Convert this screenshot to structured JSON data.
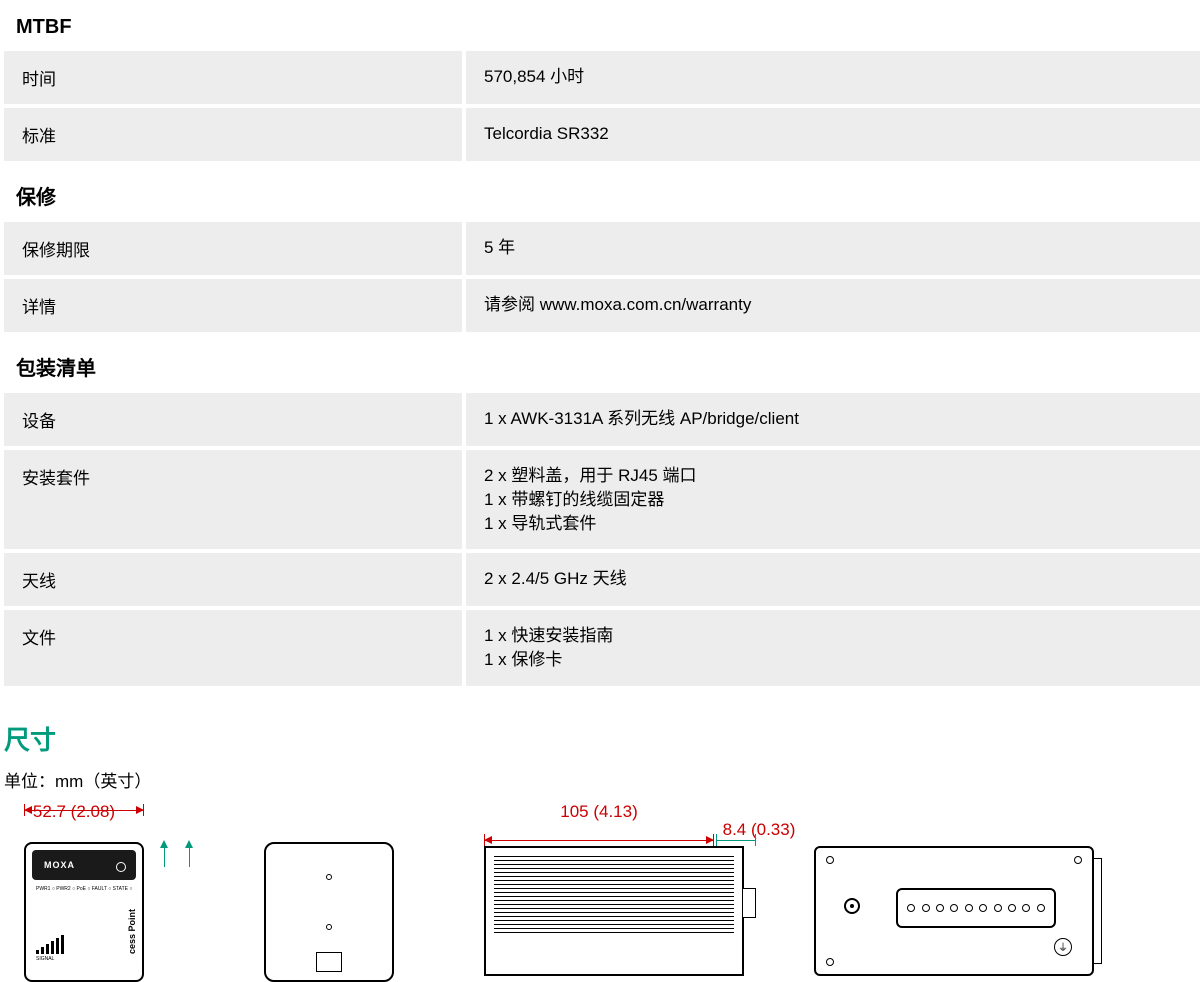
{
  "sections": {
    "mtbf": {
      "header": "MTBF",
      "rows": {
        "time_label": "时间",
        "time_value": "570,854 小时",
        "standard_label": "标准",
        "standard_value": "Telcordia SR332"
      }
    },
    "warranty": {
      "header": "保修",
      "rows": {
        "period_label": "保修期限",
        "period_value": "5 年",
        "details_label": "详情",
        "details_value": "请参阅 www.moxa.com.cn/warranty"
      }
    },
    "package": {
      "header": "包装清单",
      "rows": {
        "device_label": "设备",
        "device_value": "1 x AWK-3131A 系列无线 AP/bridge/client",
        "mounting_label": "安装套件",
        "mounting_value": "2 x 塑料盖，用于 RJ45 端口\n1 x 带螺钉的线缆固定器\n1 x 导轨式套件",
        "antenna_label": "天线",
        "antenna_value": "2 x 2.4/5 GHz 天线",
        "docs_label": "文件",
        "docs_value": "1 x 快速安装指南\n1 x 保修卡"
      }
    }
  },
  "dimensions": {
    "header": "尺寸",
    "unit": "单位：mm（英寸）",
    "dim_front_width": "52.7 (2.08)",
    "dim_side_width": "105 (4.13)",
    "dim_connector_depth": "8.4 (0.33)"
  },
  "device_labels": {
    "brand": "MOXA",
    "leds": "PWR1 ○\nPWR2 ○\nPoE ○\nFAULT ○\nSTATE ○",
    "signal": "SIGNAL",
    "ap_text": "cess Point"
  }
}
